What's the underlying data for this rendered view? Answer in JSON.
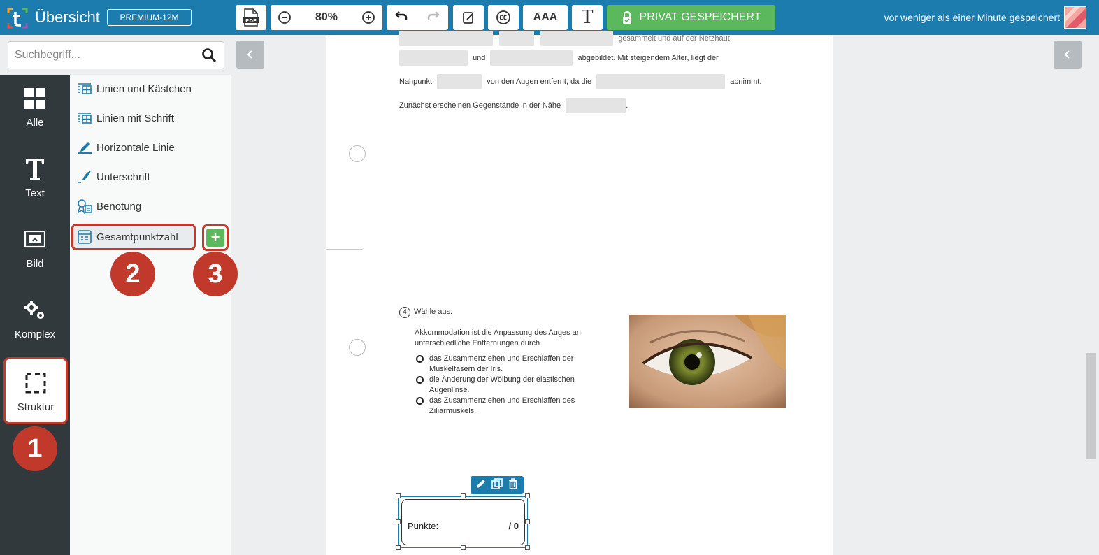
{
  "header": {
    "title": "Übersicht",
    "plan_badge": "PREMIUM-12M",
    "pdf_label": "PDF",
    "zoom": "80%",
    "font_size_label": "AAA",
    "text_tool_label": "T",
    "save_label": "PRIVAT GESPEICHERT",
    "save_status": "vor weniger als einer Minute gespeichert",
    "colors": {
      "bar": "#1d7cae",
      "save": "#5cb85c"
    }
  },
  "search": {
    "placeholder": "Suchbegriff..."
  },
  "rail": {
    "items": [
      {
        "label": "Alle",
        "icon": "grid-icon"
      },
      {
        "label": "Text",
        "icon": "text-icon"
      },
      {
        "label": "Bild",
        "icon": "image-icon"
      },
      {
        "label": "Komplex",
        "icon": "gears-icon"
      },
      {
        "label": "Struktur",
        "icon": "dashed-square-icon"
      }
    ]
  },
  "subpanel": {
    "items": [
      {
        "label": "Linien und Kästchen",
        "icon": "lines-grid-icon"
      },
      {
        "label": "Linien mit Schrift",
        "icon": "lines-grid-icon"
      },
      {
        "label": "Horizontale Linie",
        "icon": "pen-line-icon"
      },
      {
        "label": "Unterschrift",
        "icon": "signature-icon"
      },
      {
        "label": "Benotung",
        "icon": "grading-icon"
      },
      {
        "label": "Gesamtpunktzahl",
        "icon": "score-icon"
      }
    ]
  },
  "steps": [
    "1",
    "2",
    "3"
  ],
  "document": {
    "line1_a": "und",
    "line1_b": "abgebildet. Mit steigendem Alter, liegt der",
    "line2_a": "Nahpunkt",
    "line2_b": "von den Augen entfernt, da die",
    "line2_c": "abnimmt.",
    "line3_a": "Zunächst erscheinen Gegenstände in der Nähe",
    "line3_b": ".",
    "top_cut": "gesammelt und auf der Netzhaut",
    "question": {
      "number": "4",
      "title": "Wähle aus:",
      "text_1": "Akkommodation ist die Anpassung des Auges an",
      "text_2": "unterschiedliche Entfernungen durch",
      "options": [
        {
          "l1": "das Zusammenziehen und Erschlaffen der",
          "l2": "Muskelfasern der Iris."
        },
        {
          "l1": "die Änderung der Wölbung der elastischen",
          "l2": "Augenlinse."
        },
        {
          "l1": "das Zusammenziehen und Erschlaffen des",
          "l2": "Ziliarmuskels."
        }
      ]
    },
    "points": {
      "label": "Punkte:",
      "value": "/ 0"
    }
  }
}
